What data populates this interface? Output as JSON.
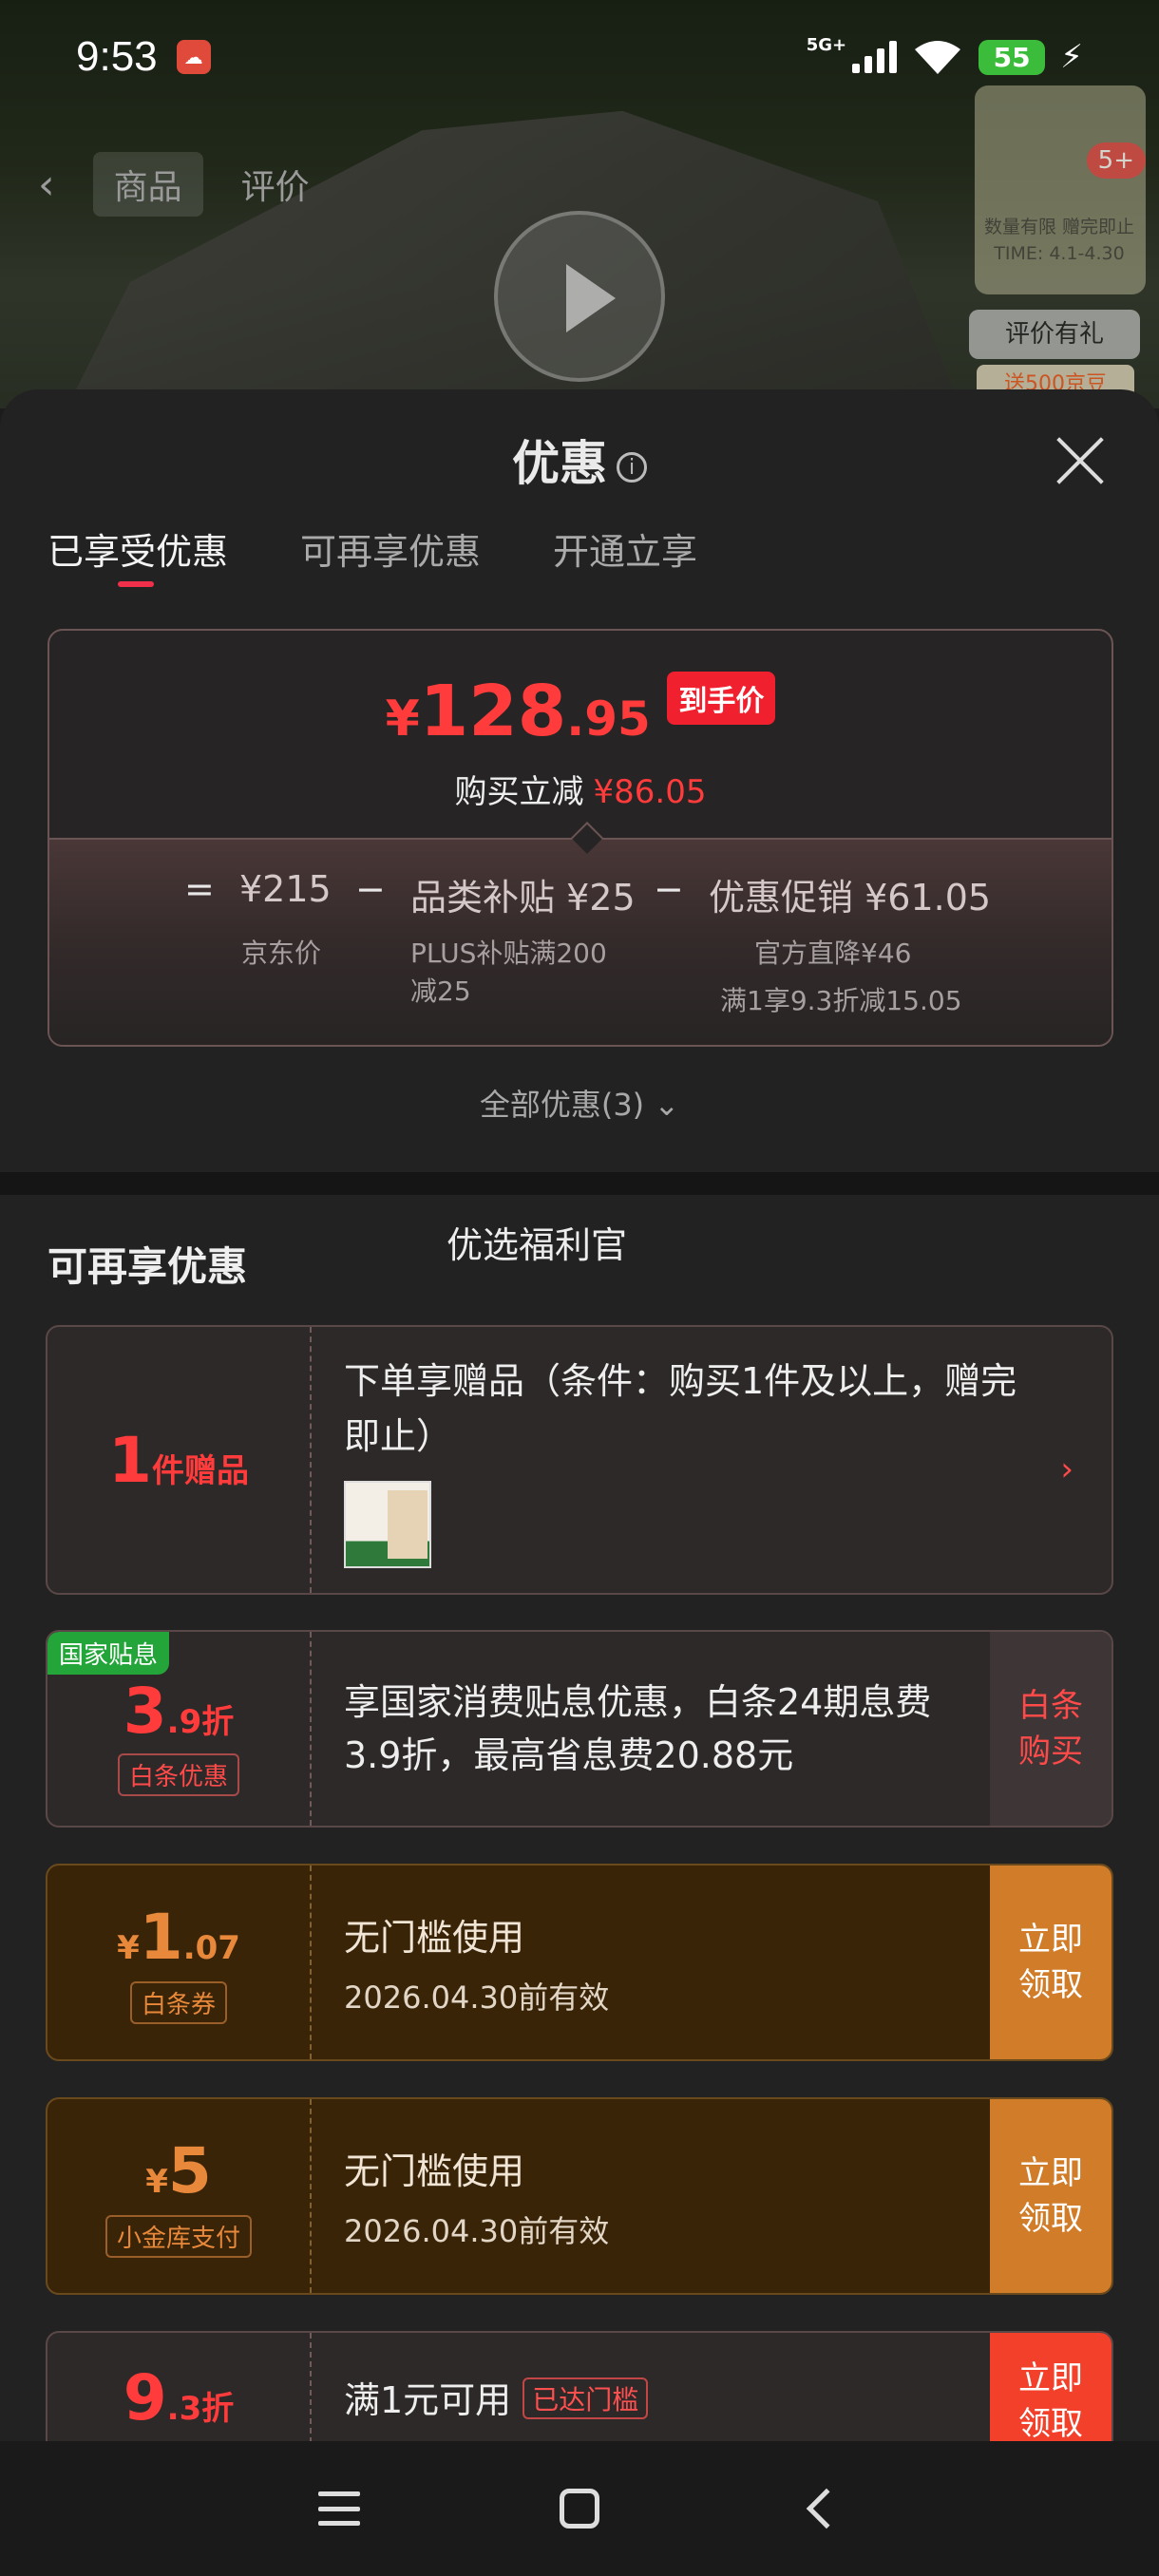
{
  "status": {
    "time": "9:53",
    "network": "5G+",
    "battery": "55"
  },
  "background": {
    "tabs": [
      "商品",
      "评价"
    ],
    "promo_text": "数量有限 赠完即止 TIME: 4.1-4.30",
    "badge": "5+",
    "review": "评价有礼",
    "beans": "送500京豆"
  },
  "sheet": {
    "title": "优惠",
    "tabs": [
      "已享受优惠",
      "可再享优惠",
      "开通立享"
    ],
    "price": {
      "yen": "¥",
      "integer": "128",
      "decimal": ".95",
      "tag": "到手价",
      "reduce_label": "购买立减",
      "reduce_amount": "¥86.05"
    },
    "formula": {
      "eq": "=",
      "minus": "−",
      "base_price": "¥215",
      "base_label": "京东价",
      "category_label": "品类补贴",
      "category_amount": "¥25",
      "category_sub": "PLUS补贴满200减25",
      "promo_label": "优惠促销",
      "promo_amount": "¥61.05",
      "promo_sub1": "官方直降¥46",
      "promo_sub2": "满1享9.3折减15.05"
    },
    "all_promos": "全部优惠(3)",
    "section_title": "可再享优惠",
    "section_sub": "优选福利官",
    "coupons": {
      "gift": {
        "num": "1",
        "unit": "件赠品",
        "desc": "下单享赠品（条件：购买1件及以上，赠完即止）"
      },
      "interest": {
        "tag": "国家贴息",
        "num": "3",
        "dec": ".9折",
        "box": "白条优惠",
        "desc": "享国家消费贴息优惠，白条24期息费3.9折，最高省息费20.88元",
        "action": "白条购买"
      },
      "baitiao": {
        "yen": "¥",
        "num": "1",
        "dec": ".07",
        "box": "白条券",
        "desc1": "无门槛使用",
        "desc2": "2026.04.30前有效",
        "action": "立即领取"
      },
      "jinku": {
        "yen": "¥",
        "num": "5",
        "box": "小金库支付",
        "desc1": "无门槛使用",
        "desc2": "2026.04.30前有效",
        "action": "立即领取"
      },
      "discount": {
        "num": "9",
        "dec": ".3折",
        "desc": "满1元可用",
        "reached": "已达门槛",
        "action": "立即领取"
      }
    }
  }
}
